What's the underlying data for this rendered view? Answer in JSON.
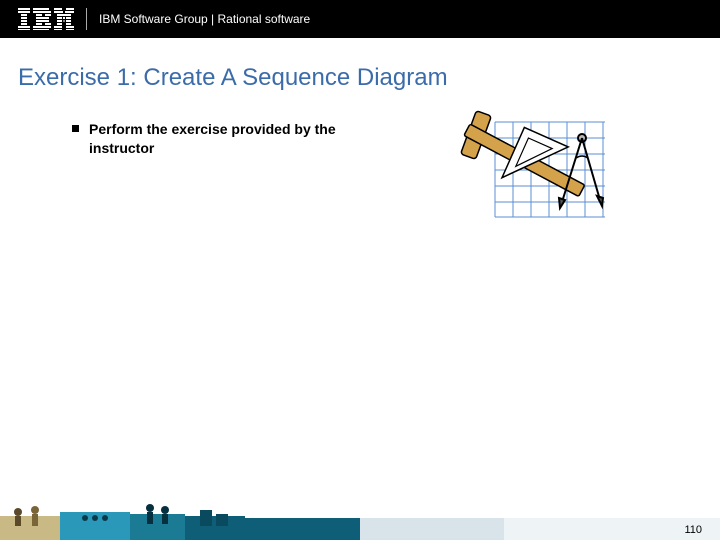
{
  "header": {
    "group_text": "IBM Software Group | Rational software"
  },
  "title": "Exercise 1: Create A Sequence Diagram",
  "bullets": [
    "Perform the exercise provided by the instructor"
  ],
  "page_number": "110"
}
